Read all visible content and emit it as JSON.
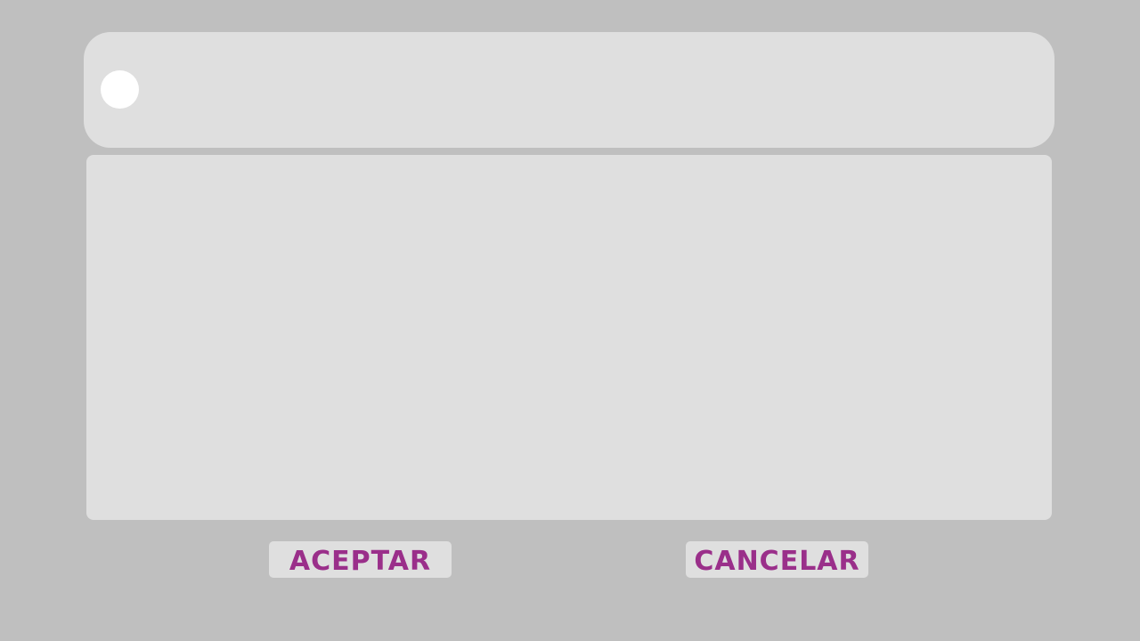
{
  "header": {
    "avatar_icon": "user-avatar-circle"
  },
  "actions": {
    "accept_label": "ACEPTAR",
    "cancel_label": "CANCELAR"
  },
  "colors": {
    "background": "#bfbfbf",
    "panel": "#dfdfdf",
    "accent_text": "#9a2f8a",
    "avatar": "#ffffff"
  }
}
